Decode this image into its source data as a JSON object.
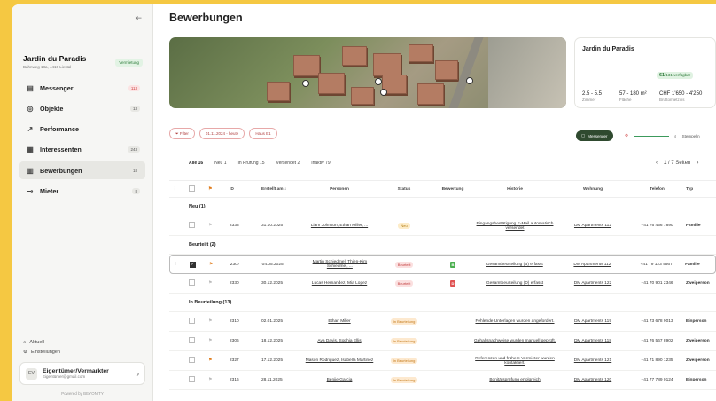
{
  "sidebar": {
    "project": {
      "name": "Jardin du Paradis",
      "address": "Bahnweg 18a, 4410 Liestal",
      "badge": "Vermietung"
    },
    "nav": [
      {
        "icon": "chat-icon",
        "glyph": "▤",
        "label": "Messenger",
        "count": "113",
        "red": true
      },
      {
        "icon": "building-icon",
        "glyph": "◎",
        "label": "Objekte",
        "count": "13"
      },
      {
        "icon": "chart-icon",
        "glyph": "↗",
        "label": "Performance",
        "count": ""
      },
      {
        "icon": "users-icon",
        "glyph": "▦",
        "label": "Interessenten",
        "count": "243"
      },
      {
        "icon": "applications-icon",
        "glyph": "▥",
        "label": "Bewerbungen",
        "count": "18",
        "active": true
      },
      {
        "icon": "key-icon",
        "glyph": "⊸",
        "label": "Mieter",
        "count": "8"
      }
    ],
    "bottom": {
      "news": "Aktuell",
      "settings": "Einstellungen"
    },
    "user": {
      "role": "Eigentümer/Vermarkter",
      "email": "Eigentümer@gmail.com",
      "initials": "EV"
    },
    "powered": "Powered by BEYONITY"
  },
  "page": {
    "title": "Bewerbungen"
  },
  "property": {
    "name": "Jardin du Paradis",
    "available": "61",
    "available_label": "/131 verfügbar",
    "stats": [
      {
        "value": "2.5 - 5.5",
        "label": "Zimmer"
      },
      {
        "value": "57 - 180 m²",
        "label": "Fläche"
      },
      {
        "value": "CHF 1'650 - 4'250",
        "label": "Bruttomietzins"
      }
    ]
  },
  "filters": [
    "Filter",
    "01.11.2024 - heute",
    "Haus B1"
  ],
  "toolbar": {
    "messenger": "Messenger",
    "search": "Stempelin"
  },
  "tabs": [
    {
      "label": "Alle",
      "count": "16",
      "active": true
    },
    {
      "label": "Neu",
      "count": "1"
    },
    {
      "label": "In Prüfung",
      "count": "15"
    },
    {
      "label": "Versendet",
      "count": "2"
    },
    {
      "label": "Inaktiv",
      "count": "79"
    }
  ],
  "pager": {
    "page": "1",
    "of": "/ 7 Seiten"
  },
  "columns": [
    "ID",
    "Erstellt am ↓",
    "Personen",
    "Status",
    "Bewertung",
    "Historie",
    "Wohnung",
    "Telefon",
    "Typ"
  ],
  "groups": [
    {
      "title": "Neu (1)",
      "rows": [
        {
          "id": "2333",
          "date": "31.10.2025",
          "persons": "Liam Johnson, Ethan Miller, ...",
          "status": "Neu",
          "sclass": "s-neu",
          "rating": "",
          "history": "Eingangsbestätigung E-Mail automatisch versendet",
          "apt": "DM Apartments 112",
          "phone": "+41 76 456 7890",
          "type": "Familie",
          "flag": false,
          "checked": false
        }
      ]
    },
    {
      "title": "Beurteilt (2)",
      "rows": [
        {
          "id": "2307",
          "date": "04.05.2025",
          "persons": "Martin Schiedmel, Thien-Kim Schiedmel, ...",
          "status": "Beurteilt",
          "sclass": "s-beurteilt",
          "rating": "B",
          "history": "Gesamtbeurteilung (B) erfasst",
          "apt": "DM Apartments 112",
          "phone": "+41 79 123 4567",
          "type": "Familie",
          "flag": true,
          "checked": true,
          "selected": true
        },
        {
          "id": "2330",
          "date": "30.12.2025",
          "persons": "Lucas Hernandez, Mia Lopez",
          "status": "Beurteilt",
          "sclass": "s-beurteilt",
          "rating": "D",
          "history": "Gesamtbeurteilung (D) erfasst",
          "apt": "DM Apartments 122",
          "phone": "+41 70 901 2346",
          "type": "Zweiperson",
          "flag": false,
          "checked": false
        }
      ]
    },
    {
      "title": "In Beurteilung (13)",
      "rows": [
        {
          "id": "2310",
          "date": "02.01.2025",
          "persons": "Ethan Miller",
          "status": "In Beurteilung",
          "sclass": "s-inb",
          "rating": "",
          "history": "Fehlende Unterlagen wurden angefordert.",
          "apt": "DM Apartments 119",
          "phone": "+41 73 678 9013",
          "type": "Einperson",
          "flag": false,
          "checked": false
        },
        {
          "id": "2306",
          "date": "18.12.2025",
          "persons": "Ava Davis, Sophia Ellis",
          "status": "In Beurteilung",
          "sclass": "s-inb",
          "rating": "",
          "history": "Gehaltsnachweise wurden manuell geprüft.",
          "apt": "DM Apartments 118",
          "phone": "+41 76 567 8902",
          "type": "Zweiperson",
          "flag": false,
          "checked": false
        },
        {
          "id": "2327",
          "date": "17.12.2025",
          "persons": "Mason Rodriguez, Isabella Martinez",
          "status": "In Beurteilung",
          "sclass": "s-inb",
          "rating": "",
          "history": "Referenzen und frühere Vermieter wurden kontaktiert.",
          "apt": "DM Apartments 121",
          "phone": "+41 71 890 1235",
          "type": "Zweiperson",
          "flag": true,
          "checked": false
        },
        {
          "id": "2316",
          "date": "28.11.2025",
          "persons": "Benjie Garcia",
          "status": "In Beurteilung",
          "sclass": "s-inb",
          "rating": "",
          "history": "Bonitätsprüfung erfolgreich",
          "apt": "DM Apartments 120",
          "phone": "+41 77 789 0124",
          "type": "Einperson",
          "flag": false,
          "checked": false
        }
      ]
    }
  ]
}
